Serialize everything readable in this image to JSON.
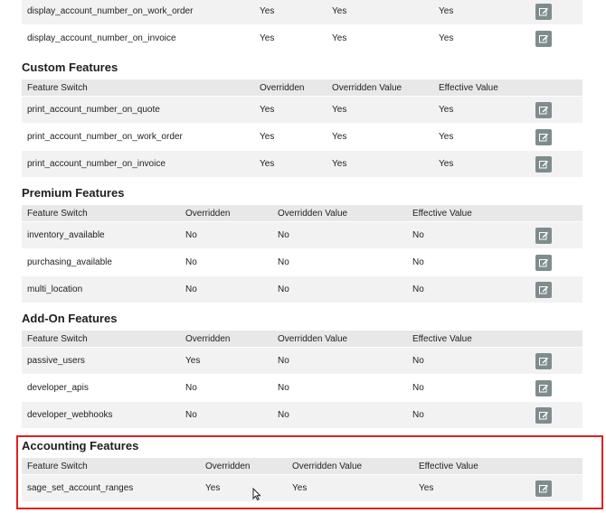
{
  "top_partial": {
    "rows": [
      {
        "switch": "display_account_number_on_work_order",
        "overridden": "Yes",
        "overridden_value": "Yes",
        "effective_value": "Yes"
      },
      {
        "switch": "display_account_number_on_invoice",
        "overridden": "Yes",
        "overridden_value": "Yes",
        "effective_value": "Yes"
      }
    ]
  },
  "custom": {
    "title": "Custom Features",
    "headers": [
      "Feature Switch",
      "Overridden",
      "Overridden Value",
      "Effective Value"
    ],
    "rows": [
      {
        "switch": "print_account_number_on_quote",
        "overridden": "Yes",
        "overridden_value": "Yes",
        "effective_value": "Yes"
      },
      {
        "switch": "print_account_number_on_work_order",
        "overridden": "Yes",
        "overridden_value": "Yes",
        "effective_value": "Yes"
      },
      {
        "switch": "print_account_number_on_invoice",
        "overridden": "Yes",
        "overridden_value": "Yes",
        "effective_value": "Yes"
      }
    ]
  },
  "premium": {
    "title": "Premium Features",
    "headers": [
      "Feature Switch",
      "Overridden",
      "Overridden Value",
      "Effective Value"
    ],
    "rows": [
      {
        "switch": "inventory_available",
        "overridden": "No",
        "overridden_value": "No",
        "effective_value": "No"
      },
      {
        "switch": "purchasing_available",
        "overridden": "No",
        "overridden_value": "No",
        "effective_value": "No"
      },
      {
        "switch": "multi_location",
        "overridden": "No",
        "overridden_value": "No",
        "effective_value": "No"
      }
    ]
  },
  "addon": {
    "title": "Add-On Features",
    "headers": [
      "Feature Switch",
      "Overridden",
      "Overridden Value",
      "Effective Value"
    ],
    "rows": [
      {
        "switch": "passive_users",
        "overridden": "Yes",
        "overridden_value": "No",
        "effective_value": "No"
      },
      {
        "switch": "developer_apis",
        "overridden": "No",
        "overridden_value": "No",
        "effective_value": "No"
      },
      {
        "switch": "developer_webhooks",
        "overridden": "No",
        "overridden_value": "No",
        "effective_value": "No"
      }
    ]
  },
  "accounting": {
    "title": "Accounting Features",
    "headers": [
      "Feature Switch",
      "Overridden",
      "Overridden Value",
      "Effective Value"
    ],
    "rows": [
      {
        "switch": "sage_set_account_ranges",
        "overridden": "Yes",
        "overridden_value": "Yes",
        "effective_value": "Yes"
      }
    ]
  },
  "icons": {
    "edit": "edit-icon",
    "cursor": "mouse-cursor-icon"
  },
  "colors": {
    "edit_button": "#7f8c8d",
    "highlight_border": "#e02020",
    "header_bg": "#e8e8e8"
  }
}
